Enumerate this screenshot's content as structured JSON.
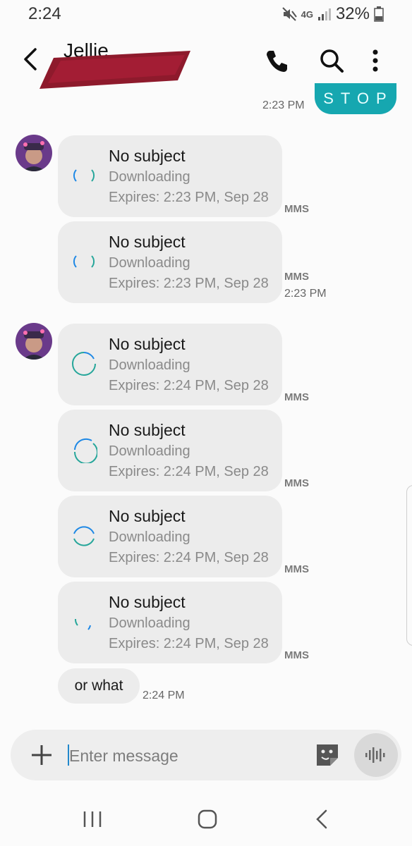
{
  "status": {
    "time": "2:24",
    "network": "4G",
    "battery": "32%"
  },
  "header": {
    "contact_name": "Jellie"
  },
  "sent_message": {
    "text": "STOP",
    "time": "2:23 PM"
  },
  "messages": [
    {
      "subject": "No subject",
      "status": "Downloading",
      "expires": "Expires: 2:23 PM, Sep 28",
      "tag": "MMS"
    },
    {
      "subject": "No subject",
      "status": "Downloading",
      "expires": "Expires: 2:23 PM, Sep 28",
      "tag": "MMS",
      "time": "2:23 PM"
    },
    {
      "subject": "No subject",
      "status": "Downloading",
      "expires": "Expires: 2:24 PM, Sep 28",
      "tag": "MMS"
    },
    {
      "subject": "No subject",
      "status": "Downloading",
      "expires": "Expires: 2:24 PM, Sep 28",
      "tag": "MMS"
    },
    {
      "subject": "No subject",
      "status": "Downloading",
      "expires": "Expires: 2:24 PM, Sep 28",
      "tag": "MMS"
    },
    {
      "subject": "No subject",
      "status": "Downloading",
      "expires": "Expires: 2:24 PM, Sep 28",
      "tag": "MMS"
    }
  ],
  "text_message": {
    "text": "or what",
    "time": "2:24 PM"
  },
  "composer": {
    "placeholder": "Enter message"
  },
  "icons": {
    "back": "back-arrow-icon",
    "call": "phone-icon",
    "search": "search-icon",
    "more": "more-vert-icon",
    "add": "plus-icon",
    "sticker": "sticker-icon",
    "voice": "voice-icon",
    "nav_recents": "recents-icon",
    "nav_home": "home-icon",
    "nav_back": "nav-back-icon"
  },
  "colors": {
    "accent": "#16a7b0",
    "bubble": "#ececec",
    "spinner_blue": "#1e88e5",
    "spinner_green": "#26a69a"
  }
}
